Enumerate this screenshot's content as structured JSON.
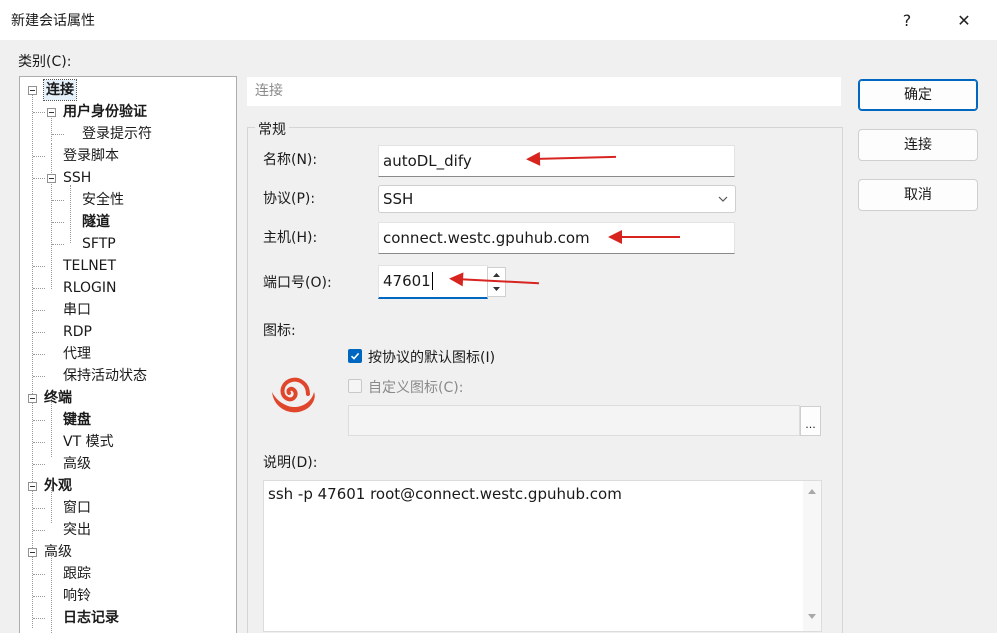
{
  "window": {
    "title": "新建会话属性",
    "help_label": "?",
    "close_label": "✕"
  },
  "category_label": "类别(C):",
  "tree": [
    {
      "label": "连接",
      "bold": true,
      "expand": true
    },
    {
      "label": "用户身份验证",
      "bold": true,
      "expand": true
    },
    {
      "label": "登录提示符"
    },
    {
      "label": "登录脚本"
    },
    {
      "label": "SSH",
      "expand": true
    },
    {
      "label": "安全性"
    },
    {
      "label": "隧道",
      "bold": true
    },
    {
      "label": "SFTP"
    },
    {
      "label": "TELNET"
    },
    {
      "label": "RLOGIN"
    },
    {
      "label": "串口"
    },
    {
      "label": "RDP"
    },
    {
      "label": "代理"
    },
    {
      "label": "保持活动状态"
    },
    {
      "label": "终端",
      "bold": true,
      "expand": true
    },
    {
      "label": "键盘",
      "bold": true
    },
    {
      "label": "VT 模式"
    },
    {
      "label": "高级"
    },
    {
      "label": "外观",
      "bold": true,
      "expand": true
    },
    {
      "label": "窗口"
    },
    {
      "label": "突出"
    },
    {
      "label": "高级",
      "expand": true
    },
    {
      "label": "跟踪"
    },
    {
      "label": "响铃"
    },
    {
      "label": "日志记录",
      "bold": true
    }
  ],
  "breadcrumb": "连接",
  "general": {
    "title": "常规",
    "name_label": "名称(N):",
    "name_value": "autoDL_dify",
    "protocol_label": "协议(P):",
    "protocol_value": "SSH",
    "host_label": "主机(H):",
    "host_value": "connect.westc.gpuhub.com",
    "port_label": "端口号(O):",
    "port_value": "47601",
    "icon_label": "图标:",
    "default_icon_label": "按协议的默认图标(I)",
    "custom_icon_label": "自定义图标(C):",
    "browse_label": "...",
    "desc_label": "说明(D):",
    "desc_value": "ssh -p 47601 root@connect.westc.gpuhub.com"
  },
  "buttons": {
    "ok": "确定",
    "connect": "连接",
    "cancel": "取消"
  },
  "colors": {
    "accent": "#0067c0",
    "annotation_arrow": "#d8241f",
    "icon_red": "#e0462b"
  },
  "icons": [
    "question-icon",
    "close-icon",
    "dropdown-chevron-icon",
    "spin-up-icon",
    "spin-down-icon",
    "session-swirl-icon",
    "checkmark-icon",
    "scroll-up-icon",
    "scroll-down-icon"
  ]
}
